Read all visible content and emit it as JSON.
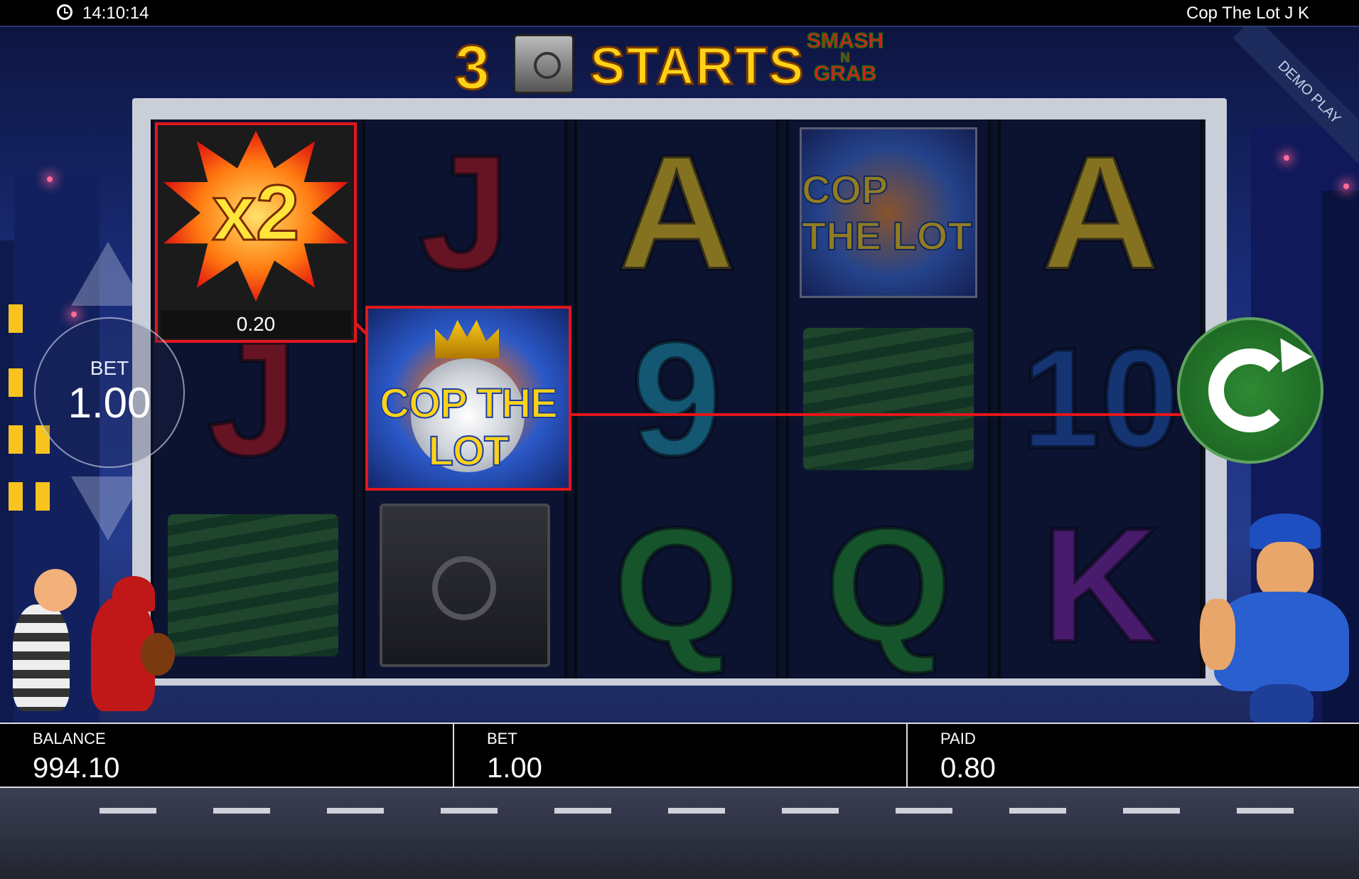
{
  "status_bar": {
    "time": "14:10:14",
    "game_title": "Cop The Lot J K"
  },
  "demo_ribbon": "DEMO PLAY",
  "banner": {
    "number": "3",
    "word": "STARTS",
    "logo_line1": "SMASH",
    "logo_line2": "N",
    "logo_line3": "GRAB"
  },
  "reels": [
    [
      "X2",
      "J",
      "cash"
    ],
    [
      "J",
      "COP THE LOT",
      "safe"
    ],
    [
      "A",
      "9",
      "Q"
    ],
    [
      "COP THE LOT",
      "cash",
      "Q"
    ],
    [
      "A",
      "10",
      "K"
    ]
  ],
  "highlight": {
    "multiplier_label": "x2",
    "multiplier_value": "0.20",
    "cop_logo": "COP THE LOT"
  },
  "bet_control": {
    "label": "BET",
    "value": "1.00"
  },
  "info_bar": {
    "balance_label": "BALANCE",
    "balance_value": "994.10",
    "bet_label": "BET",
    "bet_value": "1.00",
    "paid_label": "PAID",
    "paid_value": "0.80"
  },
  "colors": {
    "win_highlight": "#e3161b",
    "spin_button": "#1f6a25",
    "title_gold": "#ffd21a"
  },
  "icons": {
    "clock": "clock-icon",
    "spin": "spin-arrow-icon",
    "autoplay": "autoplay-icon",
    "bet_up": "chevron-up-icon",
    "bet_down": "chevron-down-icon"
  }
}
